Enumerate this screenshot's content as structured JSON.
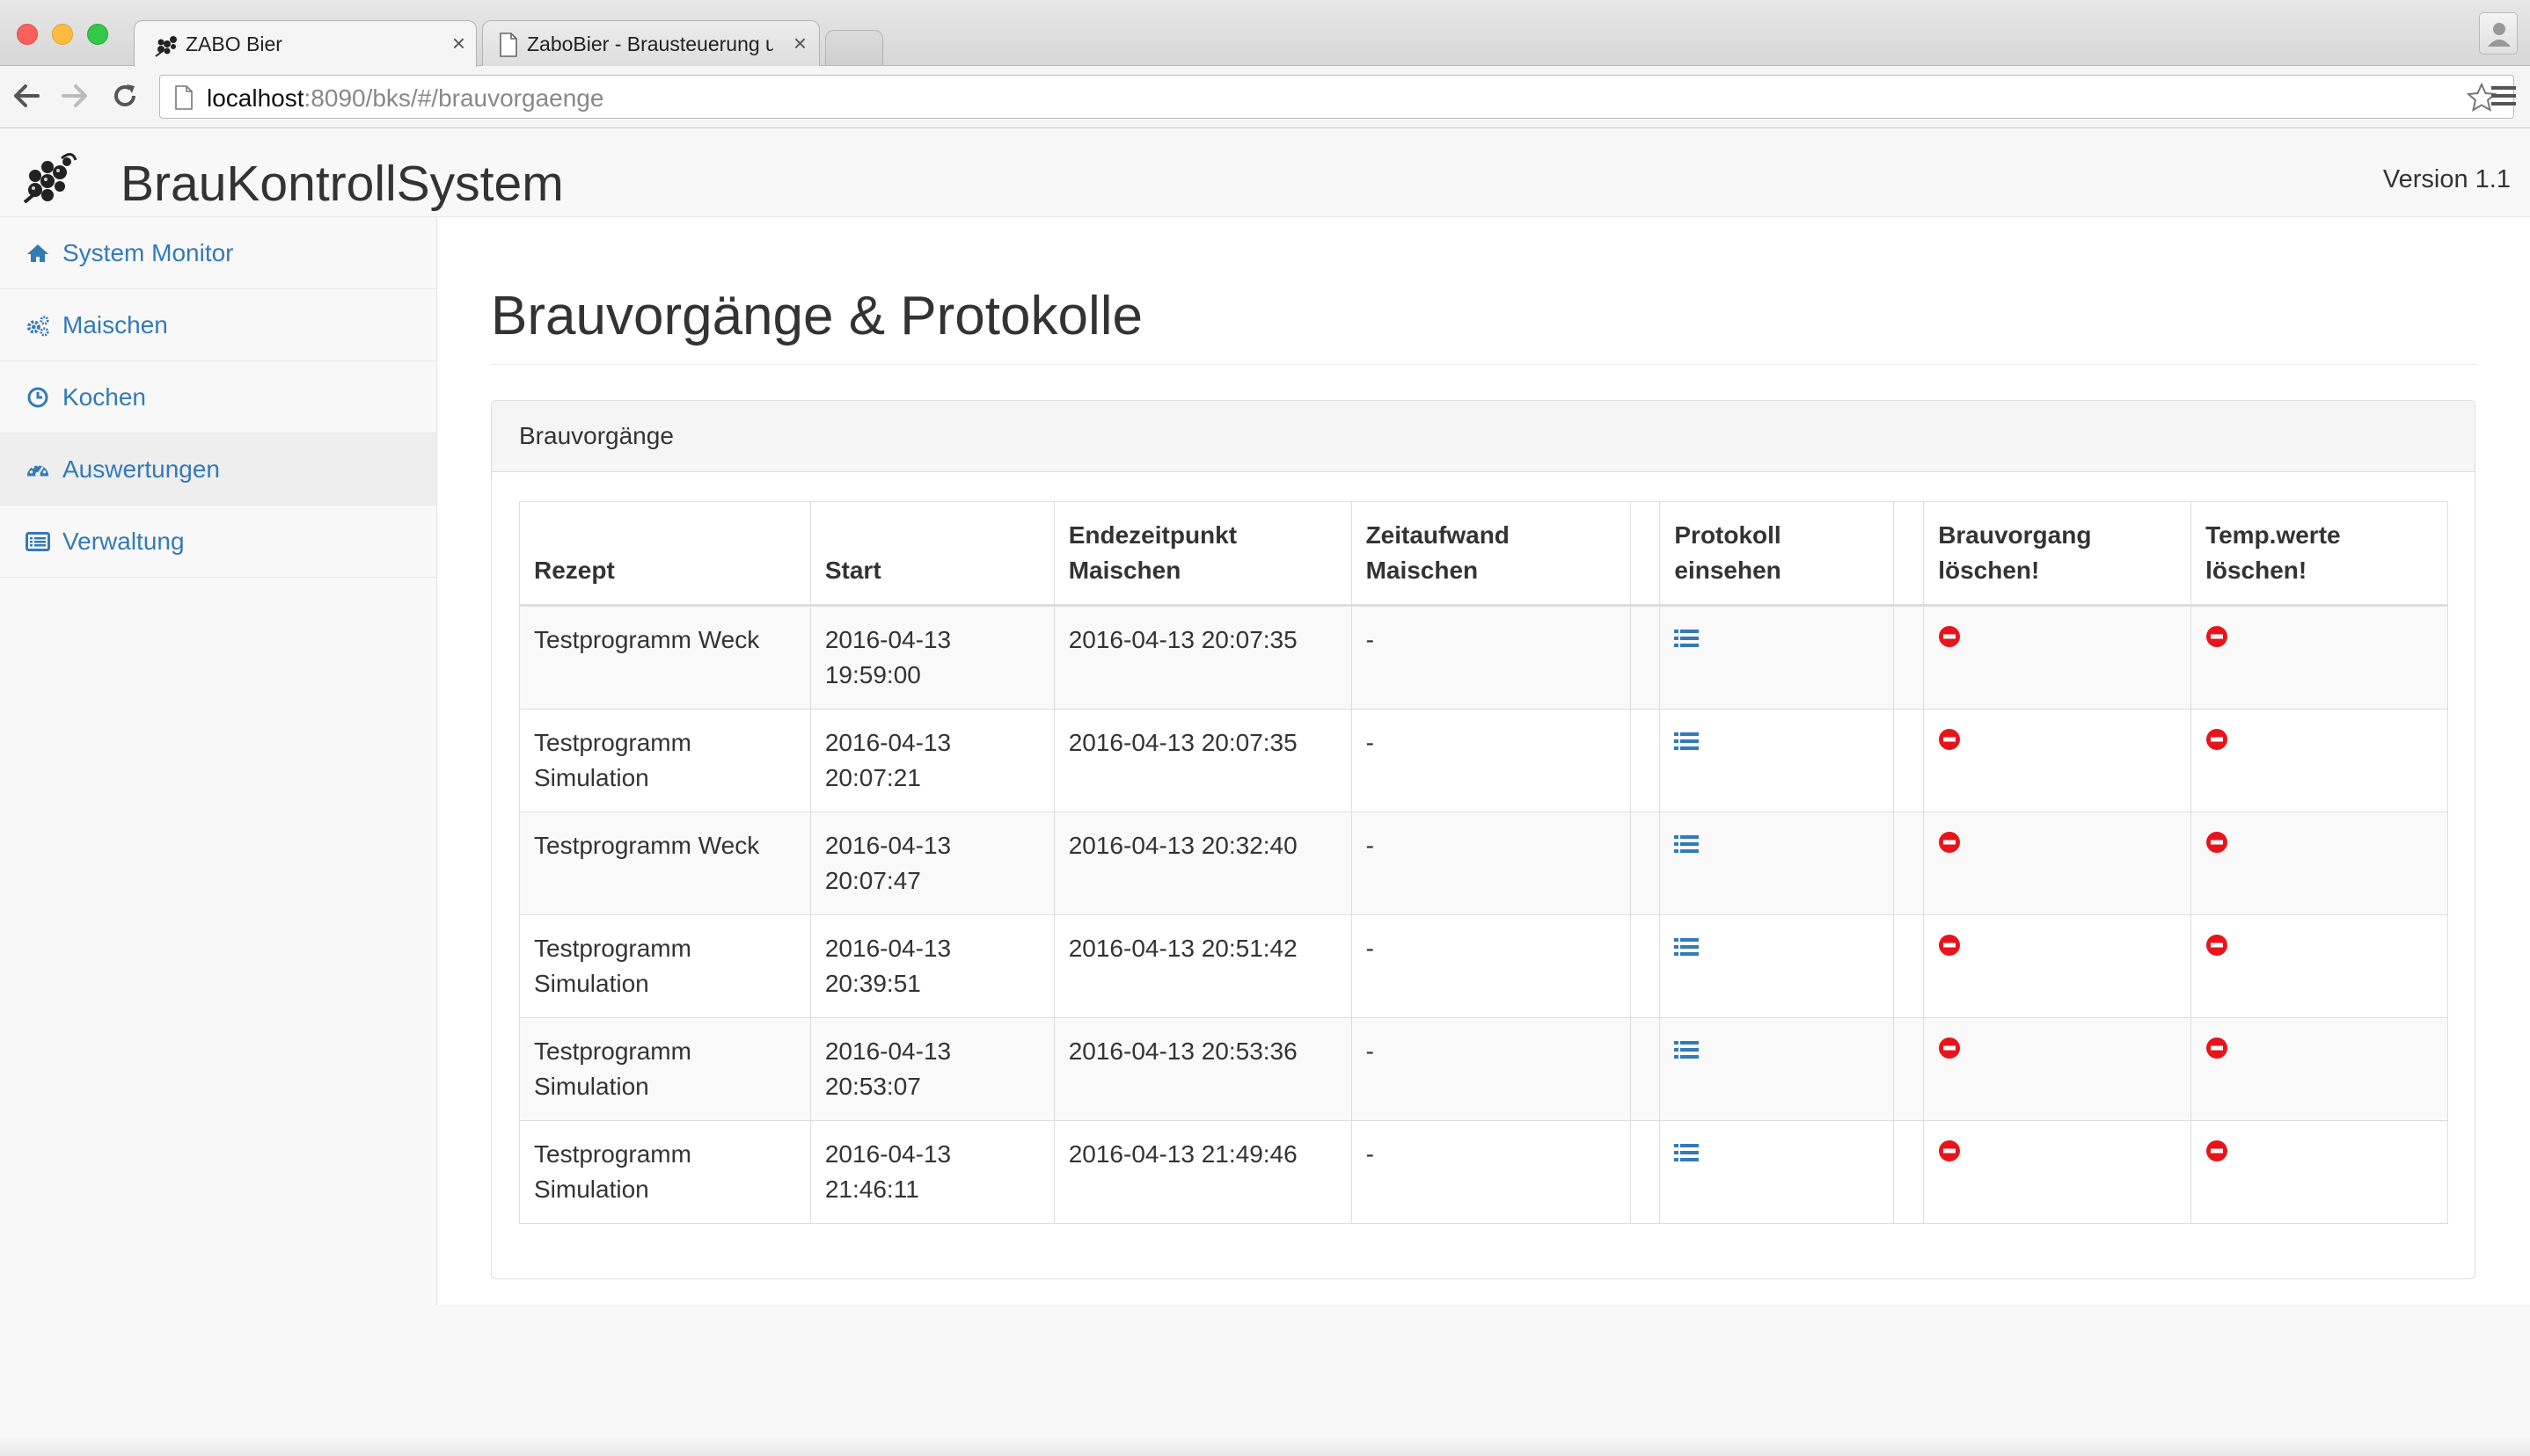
{
  "browser": {
    "tabs": [
      {
        "title": "ZABO Bier",
        "close": "×"
      },
      {
        "title": "ZaboBier - Brausteuerung u",
        "close": "×"
      }
    ],
    "url": {
      "host": "localhost",
      "rest": ":8090/bks/#/brauvorgaenge"
    }
  },
  "header": {
    "brand": "BrauKontrollSystem",
    "version": "Version 1.1"
  },
  "sidebar": {
    "items": [
      {
        "label": "System Monitor",
        "icon": "home-icon"
      },
      {
        "label": "Maischen",
        "icon": "cogs-icon"
      },
      {
        "label": "Kochen",
        "icon": "clock-icon"
      },
      {
        "label": "Auswertungen",
        "icon": "dashboard-icon"
      },
      {
        "label": "Verwaltung",
        "icon": "list-alt-icon"
      }
    ],
    "active_index": 3
  },
  "main": {
    "title": "Brauvorgänge & Protokolle",
    "panel_title": "Brauvorgänge",
    "columns": [
      [
        "Rezept"
      ],
      [
        "Start"
      ],
      [
        "Endezeitpunkt",
        "Maischen"
      ],
      [
        "Zeitaufwand",
        "Maischen"
      ],
      [
        ""
      ],
      [
        "Protokoll",
        "einsehen"
      ],
      [
        ""
      ],
      [
        "Brauvorgang",
        "löschen!"
      ],
      [
        "Temp.werte",
        "löschen!"
      ]
    ],
    "rows": [
      {
        "rezept": [
          "Testprogramm Weck"
        ],
        "start": [
          "2016-04-13",
          "19:59:00"
        ],
        "ende": "2016-04-13 20:07:35",
        "zeit": "-"
      },
      {
        "rezept": [
          "Testprogramm",
          "Simulation"
        ],
        "start": [
          "2016-04-13",
          "20:07:21"
        ],
        "ende": "2016-04-13 20:07:35",
        "zeit": "-"
      },
      {
        "rezept": [
          "Testprogramm Weck"
        ],
        "start": [
          "2016-04-13",
          "20:07:47"
        ],
        "ende": "2016-04-13 20:32:40",
        "zeit": "-"
      },
      {
        "rezept": [
          "Testprogramm",
          "Simulation"
        ],
        "start": [
          "2016-04-13",
          "20:39:51"
        ],
        "ende": "2016-04-13 20:51:42",
        "zeit": "-"
      },
      {
        "rezept": [
          "Testprogramm",
          "Simulation"
        ],
        "start": [
          "2016-04-13",
          "20:53:07"
        ],
        "ende": "2016-04-13 20:53:36",
        "zeit": "-"
      },
      {
        "rezept": [
          "Testprogramm",
          "Simulation"
        ],
        "start": [
          "2016-04-13",
          "21:46:11"
        ],
        "ende": "2016-04-13 21:49:46",
        "zeit": "-"
      }
    ]
  },
  "colors": {
    "link": "#337ab7",
    "delete": "#e8141b",
    "border": "#dddddd"
  }
}
